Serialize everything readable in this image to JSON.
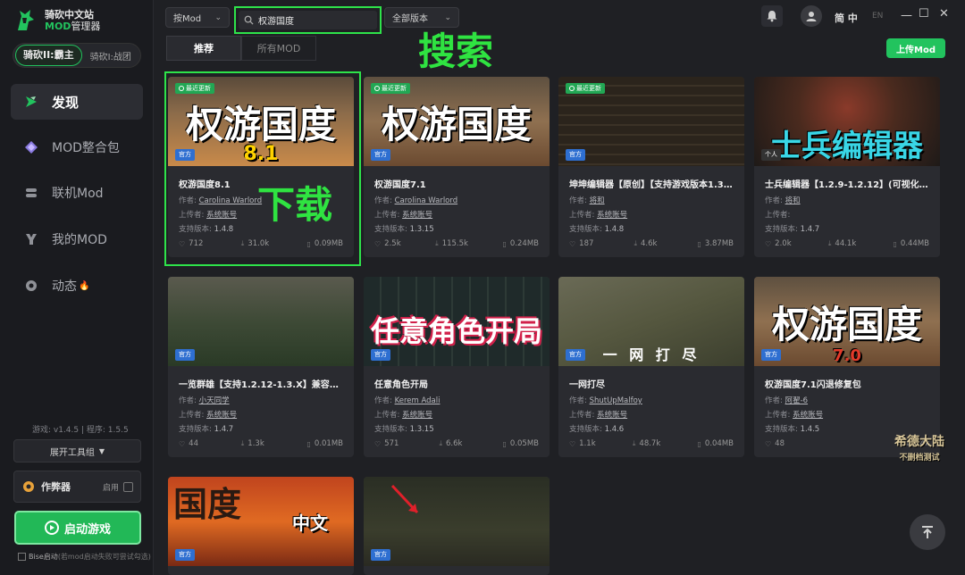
{
  "app": {
    "title": "骑砍中文站",
    "subtitle_mod": "MOD",
    "subtitle_rest": "管理器"
  },
  "game_switch": {
    "active": "骑砍II:霸主",
    "other": "骑砍I:战团"
  },
  "nav": [
    {
      "label": "发现",
      "icon": "discover-icon"
    },
    {
      "label": "MOD整合包",
      "icon": "diamond-icon"
    },
    {
      "label": "联机Mod",
      "icon": "multiplayer-icon"
    },
    {
      "label": "我的MOD",
      "icon": "my-mod-icon"
    },
    {
      "label": "动态",
      "icon": "chat-icon"
    }
  ],
  "versions": "游戏: v1.4.5 | 程序: 1.5.5",
  "toolbox": "展开工具组",
  "cheat": {
    "label": "作弊器",
    "enable": "启用"
  },
  "launch": "启动游戏",
  "bise": {
    "label": "Bise启动",
    "hint": "(若mod启动失败可尝试勾选)"
  },
  "topbar": {
    "filter": "按Mod",
    "search_value": "权游国度",
    "version_filter": "全部版本",
    "lang_active": "简 中",
    "lang_other": "EN"
  },
  "annotations": {
    "search": "搜索",
    "download": "下载"
  },
  "tabs": [
    "推荐",
    "所有MOD"
  ],
  "upload": "上传Mod",
  "labels": {
    "author": "作者:",
    "uploader": "上传者:",
    "version": "支持版本:",
    "official": "官方",
    "personal": "个人",
    "recent": "最近更新"
  },
  "cards": [
    {
      "thumb_text": "权游国度",
      "thumb_sub": "8.1",
      "recent": true,
      "official": true,
      "title": "权游国度8.1",
      "author": "Carolina Warlord",
      "uploader": "系统账号",
      "version": "1.4.8",
      "likes": "712",
      "downloads": "31.0k",
      "size": "0.09MB"
    },
    {
      "thumb_text": "权游国度",
      "thumb_sub": "",
      "recent": true,
      "official": true,
      "title": "权游国度7.1",
      "author": "Carolina Warlord",
      "uploader": "系统账号",
      "version": "1.3.15",
      "likes": "2.5k",
      "downloads": "115.5k",
      "size": "0.24MB"
    },
    {
      "thumb_text": "",
      "thumb_sub": "",
      "recent": true,
      "official": true,
      "title": "坤坤编辑器【原创】【支持游戏版本1.3.15+】",
      "author": "将和",
      "uploader": "系统账号",
      "version": "1.4.8",
      "likes": "187",
      "downloads": "4.6k",
      "size": "3.87MB"
    },
    {
      "thumb_text": "士兵编辑器",
      "thumb_sub": "",
      "recent": false,
      "official": false,
      "title": "士兵编辑器【1.2.9-1.2.12】(可视化自定义)",
      "author": "将和",
      "uploader": "",
      "version": "1.4.7",
      "likes": "2.0k",
      "downloads": "44.1k",
      "size": "0.44MB"
    },
    {
      "thumb_text": "",
      "thumb_sub": "",
      "recent": false,
      "official": true,
      "title": "一览群雄【支持1.2.12-1.3.X】兼容衣谷...",
      "author": "小天同学",
      "uploader": "系统账号",
      "version": "1.4.7",
      "likes": "44",
      "downloads": "1.3k",
      "size": "0.01MB"
    },
    {
      "thumb_text": "任意角色开局",
      "thumb_sub": "",
      "recent": false,
      "official": true,
      "title": "任意角色开局",
      "author": "Kerem Adali",
      "uploader": "系统账号",
      "version": "1.3.15",
      "likes": "571",
      "downloads": "6.6k",
      "size": "0.05MB"
    },
    {
      "thumb_text": "一 网 打 尽",
      "thumb_sub": "",
      "recent": false,
      "official": true,
      "title": "一网打尽",
      "author": "ShutUpMalfoy",
      "uploader": "系统账号",
      "version": "1.4.6",
      "likes": "1.1k",
      "downloads": "48.7k",
      "size": "0.04MB"
    },
    {
      "thumb_text": "权游国度",
      "thumb_sub": "7.0",
      "recent": false,
      "official": true,
      "title": "权游国度7.1闪退修复包",
      "author": "阿翟-6",
      "uploader": "系统账号",
      "version": "1.4.5",
      "likes": "48",
      "downloads": "1.4k",
      "size": ""
    },
    {
      "thumb_text": "国度",
      "thumb_sub": "中文",
      "recent": false,
      "official": true,
      "title": "",
      "author": "",
      "uploader": "",
      "version": "",
      "likes": "",
      "downloads": "",
      "size": ""
    },
    {
      "thumb_text": "",
      "thumb_sub": "",
      "recent": false,
      "official": true,
      "title": "",
      "author": "",
      "uploader": "",
      "version": "",
      "likes": "",
      "downloads": "",
      "size": ""
    }
  ],
  "watermark": {
    "line1": "希德大陆",
    "line2": "不删档测试"
  },
  "colors": {
    "accent": "#22c35e",
    "annotation": "#2ee34a",
    "official_badge": "#2e6fd1",
    "bg": "#1f2024",
    "card": "#2a2b30"
  }
}
